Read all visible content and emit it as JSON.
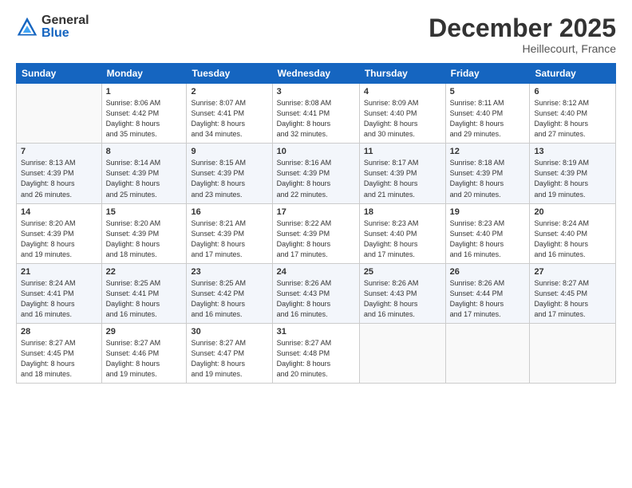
{
  "header": {
    "logo_general": "General",
    "logo_blue": "Blue",
    "month_title": "December 2025",
    "location": "Heillecourt, France"
  },
  "calendar": {
    "days_of_week": [
      "Sunday",
      "Monday",
      "Tuesday",
      "Wednesday",
      "Thursday",
      "Friday",
      "Saturday"
    ],
    "weeks": [
      [
        {
          "day": "",
          "info": ""
        },
        {
          "day": "1",
          "info": "Sunrise: 8:06 AM\nSunset: 4:42 PM\nDaylight: 8 hours\nand 35 minutes."
        },
        {
          "day": "2",
          "info": "Sunrise: 8:07 AM\nSunset: 4:41 PM\nDaylight: 8 hours\nand 34 minutes."
        },
        {
          "day": "3",
          "info": "Sunrise: 8:08 AM\nSunset: 4:41 PM\nDaylight: 8 hours\nand 32 minutes."
        },
        {
          "day": "4",
          "info": "Sunrise: 8:09 AM\nSunset: 4:40 PM\nDaylight: 8 hours\nand 30 minutes."
        },
        {
          "day": "5",
          "info": "Sunrise: 8:11 AM\nSunset: 4:40 PM\nDaylight: 8 hours\nand 29 minutes."
        },
        {
          "day": "6",
          "info": "Sunrise: 8:12 AM\nSunset: 4:40 PM\nDaylight: 8 hours\nand 27 minutes."
        }
      ],
      [
        {
          "day": "7",
          "info": "Sunrise: 8:13 AM\nSunset: 4:39 PM\nDaylight: 8 hours\nand 26 minutes."
        },
        {
          "day": "8",
          "info": "Sunrise: 8:14 AM\nSunset: 4:39 PM\nDaylight: 8 hours\nand 25 minutes."
        },
        {
          "day": "9",
          "info": "Sunrise: 8:15 AM\nSunset: 4:39 PM\nDaylight: 8 hours\nand 23 minutes."
        },
        {
          "day": "10",
          "info": "Sunrise: 8:16 AM\nSunset: 4:39 PM\nDaylight: 8 hours\nand 22 minutes."
        },
        {
          "day": "11",
          "info": "Sunrise: 8:17 AM\nSunset: 4:39 PM\nDaylight: 8 hours\nand 21 minutes."
        },
        {
          "day": "12",
          "info": "Sunrise: 8:18 AM\nSunset: 4:39 PM\nDaylight: 8 hours\nand 20 minutes."
        },
        {
          "day": "13",
          "info": "Sunrise: 8:19 AM\nSunset: 4:39 PM\nDaylight: 8 hours\nand 19 minutes."
        }
      ],
      [
        {
          "day": "14",
          "info": "Sunrise: 8:20 AM\nSunset: 4:39 PM\nDaylight: 8 hours\nand 19 minutes."
        },
        {
          "day": "15",
          "info": "Sunrise: 8:20 AM\nSunset: 4:39 PM\nDaylight: 8 hours\nand 18 minutes."
        },
        {
          "day": "16",
          "info": "Sunrise: 8:21 AM\nSunset: 4:39 PM\nDaylight: 8 hours\nand 17 minutes."
        },
        {
          "day": "17",
          "info": "Sunrise: 8:22 AM\nSunset: 4:39 PM\nDaylight: 8 hours\nand 17 minutes."
        },
        {
          "day": "18",
          "info": "Sunrise: 8:23 AM\nSunset: 4:40 PM\nDaylight: 8 hours\nand 17 minutes."
        },
        {
          "day": "19",
          "info": "Sunrise: 8:23 AM\nSunset: 4:40 PM\nDaylight: 8 hours\nand 16 minutes."
        },
        {
          "day": "20",
          "info": "Sunrise: 8:24 AM\nSunset: 4:40 PM\nDaylight: 8 hours\nand 16 minutes."
        }
      ],
      [
        {
          "day": "21",
          "info": "Sunrise: 8:24 AM\nSunset: 4:41 PM\nDaylight: 8 hours\nand 16 minutes."
        },
        {
          "day": "22",
          "info": "Sunrise: 8:25 AM\nSunset: 4:41 PM\nDaylight: 8 hours\nand 16 minutes."
        },
        {
          "day": "23",
          "info": "Sunrise: 8:25 AM\nSunset: 4:42 PM\nDaylight: 8 hours\nand 16 minutes."
        },
        {
          "day": "24",
          "info": "Sunrise: 8:26 AM\nSunset: 4:43 PM\nDaylight: 8 hours\nand 16 minutes."
        },
        {
          "day": "25",
          "info": "Sunrise: 8:26 AM\nSunset: 4:43 PM\nDaylight: 8 hours\nand 16 minutes."
        },
        {
          "day": "26",
          "info": "Sunrise: 8:26 AM\nSunset: 4:44 PM\nDaylight: 8 hours\nand 17 minutes."
        },
        {
          "day": "27",
          "info": "Sunrise: 8:27 AM\nSunset: 4:45 PM\nDaylight: 8 hours\nand 17 minutes."
        }
      ],
      [
        {
          "day": "28",
          "info": "Sunrise: 8:27 AM\nSunset: 4:45 PM\nDaylight: 8 hours\nand 18 minutes."
        },
        {
          "day": "29",
          "info": "Sunrise: 8:27 AM\nSunset: 4:46 PM\nDaylight: 8 hours\nand 19 minutes."
        },
        {
          "day": "30",
          "info": "Sunrise: 8:27 AM\nSunset: 4:47 PM\nDaylight: 8 hours\nand 19 minutes."
        },
        {
          "day": "31",
          "info": "Sunrise: 8:27 AM\nSunset: 4:48 PM\nDaylight: 8 hours\nand 20 minutes."
        },
        {
          "day": "",
          "info": ""
        },
        {
          "day": "",
          "info": ""
        },
        {
          "day": "",
          "info": ""
        }
      ]
    ]
  }
}
